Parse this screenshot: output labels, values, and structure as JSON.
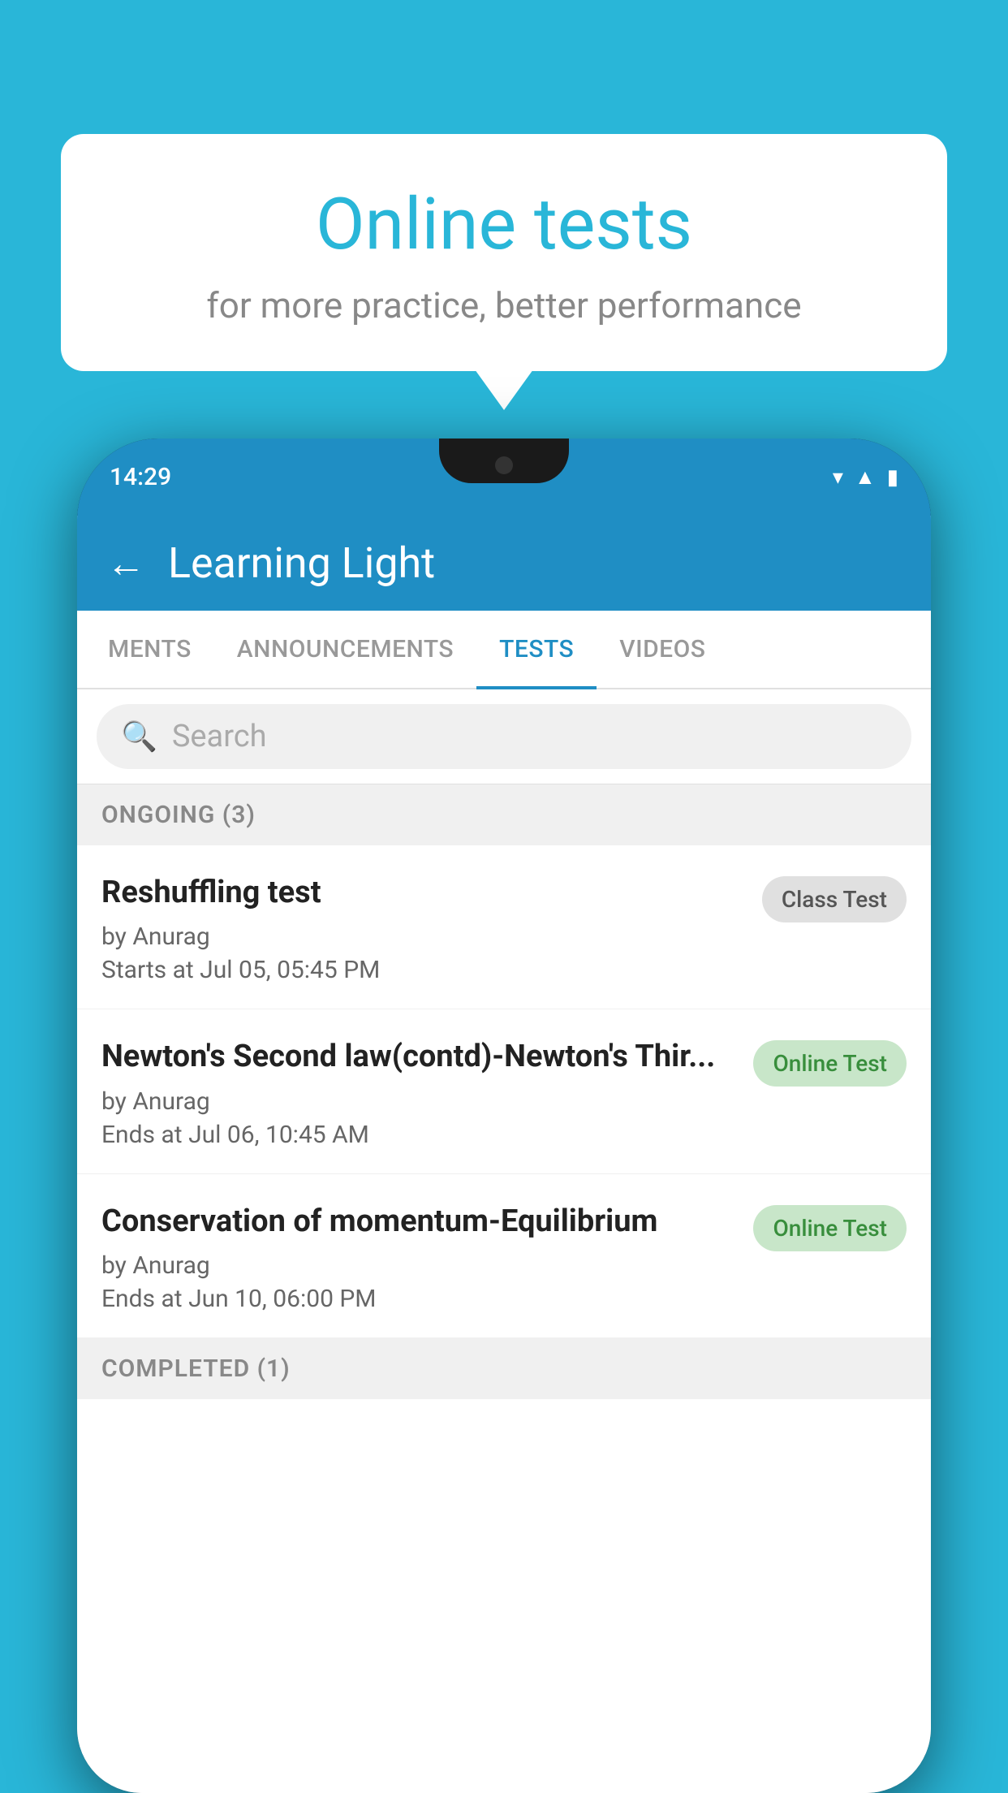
{
  "background_color": "#29b6d8",
  "bubble": {
    "title": "Online tests",
    "subtitle": "for more practice, better performance"
  },
  "phone": {
    "status_bar": {
      "time": "14:29",
      "icons": [
        "wifi",
        "signal",
        "battery"
      ]
    },
    "app_header": {
      "title": "Learning Light",
      "back_label": "←"
    },
    "tabs": [
      {
        "label": "MENTS",
        "active": false
      },
      {
        "label": "ANNOUNCEMENTS",
        "active": false
      },
      {
        "label": "TESTS",
        "active": true
      },
      {
        "label": "VIDEOS",
        "active": false
      }
    ],
    "search": {
      "placeholder": "Search"
    },
    "ongoing_section": {
      "label": "ONGOING (3)",
      "tests": [
        {
          "name": "Reshuffling test",
          "author": "by Anurag",
          "time_label": "Starts at",
          "time_value": "Jul 05, 05:45 PM",
          "badge": "Class Test",
          "badge_type": "gray"
        },
        {
          "name": "Newton's Second law(contd)-Newton's Thir...",
          "author": "by Anurag",
          "time_label": "Ends at",
          "time_value": "Jul 06, 10:45 AM",
          "badge": "Online Test",
          "badge_type": "green"
        },
        {
          "name": "Conservation of momentum-Equilibrium",
          "author": "by Anurag",
          "time_label": "Ends at",
          "time_value": "Jun 10, 06:00 PM",
          "badge": "Online Test",
          "badge_type": "green"
        }
      ]
    },
    "completed_section": {
      "label": "COMPLETED (1)"
    }
  }
}
